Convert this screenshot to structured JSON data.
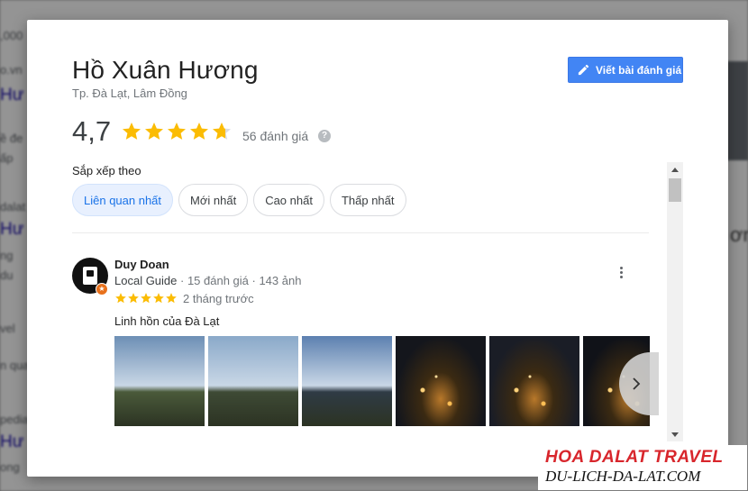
{
  "place": {
    "name": "Hồ Xuân Hương",
    "location": "Tp. Đà Lạt, Lâm Đồng",
    "rating": "4,7",
    "rating_value": 4.7,
    "review_count": "56 đánh giá",
    "write_review_label": "Viết bài đánh giá"
  },
  "sort": {
    "label": "Sắp xếp theo",
    "options": [
      "Liên quan nhất",
      "Mới nhất",
      "Cao nhất",
      "Thấp nhất"
    ],
    "selected": "Liên quan nhất"
  },
  "review": {
    "author": "Duy Doan",
    "guide_label": "Local Guide",
    "meta": " · 15 đánh giá · 143 ảnh",
    "stars": 5,
    "time": "2 tháng trước",
    "text": "Linh hồn của Đà Lạt",
    "photos": [
      {
        "name": "photo-sunrise-lake",
        "sky": "#6d8fb5",
        "ground": "#4a5a3a"
      },
      {
        "name": "photo-sun-over-lake",
        "sky": "#8aa9c9",
        "ground": "#3e4a35"
      },
      {
        "name": "photo-sun-horizon",
        "sky": "#5c80b0",
        "ground": "#2f3b45"
      },
      {
        "name": "photo-night-city-1",
        "sky": "#14161c",
        "ground": "#3a2a10"
      },
      {
        "name": "photo-night-city-2",
        "sky": "#1a1d26",
        "ground": "#2b3340"
      },
      {
        "name": "photo-night-city-3",
        "sky": "#101218",
        "ground": "#222"
      }
    ]
  },
  "watermark": {
    "line1": "HOA DALAT TRAVEL",
    "line2": "DU-LICH-DA-LAT.COM"
  },
  "colors": {
    "star": "#fbbc04",
    "button": "#4285f4",
    "chip_active_bg": "#e8f0fe",
    "watermark_red": "#d8262c"
  }
}
